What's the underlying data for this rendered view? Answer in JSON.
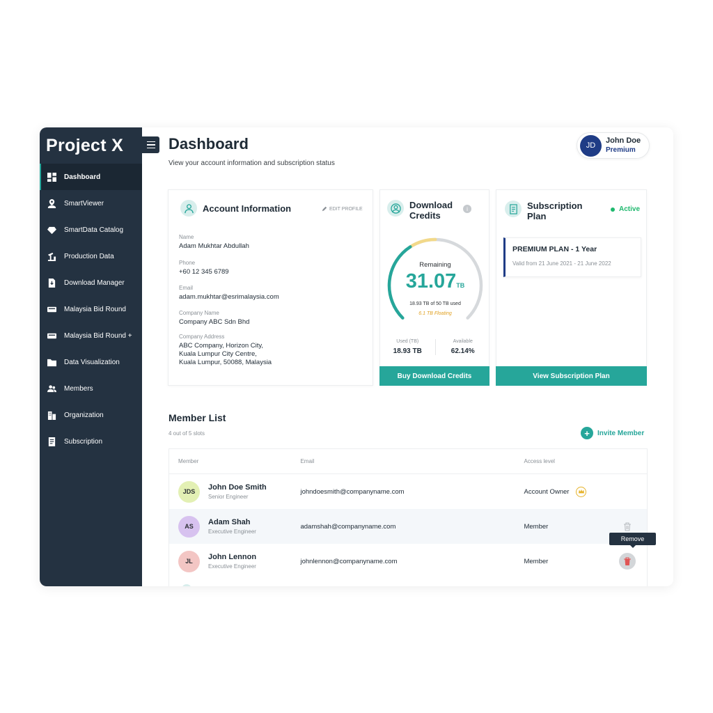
{
  "app": {
    "brand": "Project X"
  },
  "sidebar": {
    "items": [
      {
        "label": "Dashboard",
        "icon": "dashboard-icon",
        "active": true
      },
      {
        "label": "SmartViewer",
        "icon": "map-pin-icon"
      },
      {
        "label": "SmartData Catalog",
        "icon": "diamond-icon"
      },
      {
        "label": "Production Data",
        "icon": "oil-pump-icon"
      },
      {
        "label": "Download Manager",
        "icon": "download-file-icon"
      },
      {
        "label": "Malaysia Bid Round",
        "icon": "mbr-badge-icon"
      },
      {
        "label": "Malaysia Bid Round +",
        "icon": "mbr-plus-badge-icon"
      },
      {
        "label": "Data Visualization",
        "icon": "folder-icon"
      },
      {
        "label": "Members",
        "icon": "members-icon"
      },
      {
        "label": "Organization",
        "icon": "building-icon"
      },
      {
        "label": "Subscription",
        "icon": "document-icon"
      }
    ]
  },
  "header": {
    "title": "Dashboard",
    "subtitle": "View your account information and subscription status",
    "user": {
      "initials": "JD",
      "name": "John Doe",
      "tier": "Premium"
    }
  },
  "account": {
    "title": "Account Information",
    "edit_label": "EDIT PROFILE",
    "fields": {
      "name": {
        "label": "Name",
        "value": "Adam Mukhtar Abdullah"
      },
      "phone": {
        "label": "Phone",
        "value": "+60 12 345 6789"
      },
      "email": {
        "label": "Email",
        "value": "adam.mukhtar@esrimalaysia.com"
      },
      "company": {
        "label": "Company Name",
        "value": "Company ABC Sdn Bhd"
      },
      "address": {
        "label": "Company Address",
        "line1": "ABC Company, Horizon City,",
        "line2": "Kuala Lumpur City Centre,",
        "line3": "Kuala Lumpur, 50088, Malaysia"
      }
    }
  },
  "credits": {
    "title_line1": "Download",
    "title_line2": "Credits",
    "info_glyph": "i",
    "remaining_label": "Remaining",
    "remaining_value": "31.07",
    "unit": "TB",
    "used_text": "18.93 TB of 50 TB used",
    "floating_text": "6.1 TB Floating",
    "gauge_used_fraction": 0.3786,
    "gauge_floating_fraction": 0.122,
    "used_label": "Used (TB)",
    "used_value": "18.93 TB",
    "available_label": "Available",
    "available_value": "62.14%",
    "button": "Buy Download Credits",
    "colors": {
      "remaining": "#26a69a",
      "floating": "#f2d98a",
      "track": "#d6d9dc"
    }
  },
  "subscription": {
    "title_line1": "Subscription",
    "title_line2": "Plan",
    "status": "Active",
    "plan_name": "PREMIUM PLAN - 1 Year",
    "plan_valid": "Valid from 21 June 2021 - 21 June 2022",
    "button": "View Subscription Plan"
  },
  "members": {
    "title": "Member List",
    "slots": "4 out of 5 slots",
    "invite_label": "Invite Member",
    "columns": {
      "member": "Member",
      "email": "Email",
      "access": "Access level"
    },
    "rows": [
      {
        "initials": "JDS",
        "name": "John Doe Smith",
        "role": "Senior Engineer",
        "email": "johndoesmith@companyname.com",
        "access": "Account Owner",
        "avatar_color": "#e3f0b4"
      },
      {
        "initials": "AS",
        "name": "Adam Shah",
        "role": "Executive Engineer",
        "email": "adamshah@companyname.com",
        "access": "Member",
        "avatar_color": "#d7c2ef"
      },
      {
        "initials": "JL",
        "name": "John Lennon",
        "role": "Executive Engineer",
        "email": "johnlennon@companyname.com",
        "access": "Member",
        "avatar_color": "#f3c6c4"
      }
    ],
    "remove_tooltip": "Remove"
  },
  "colors": {
    "accent": "#26a69a",
    "sidebar": "#243241",
    "brand_blue": "#1f3c86",
    "active_green": "#1fb86e",
    "danger": "#e05555"
  }
}
